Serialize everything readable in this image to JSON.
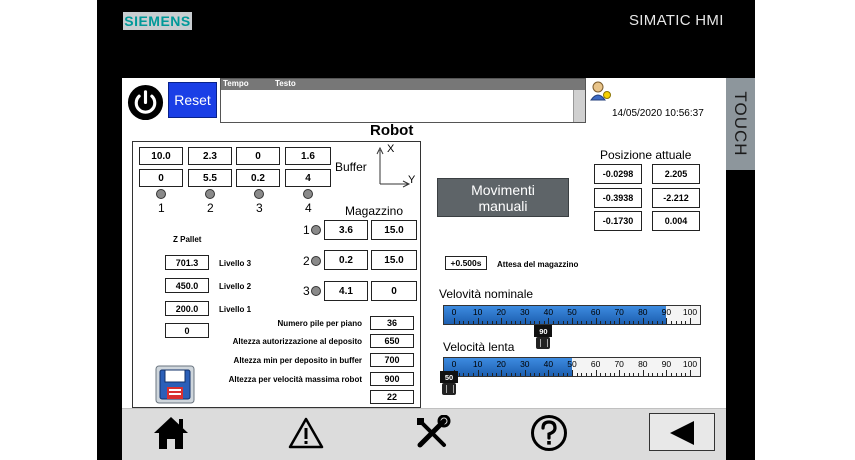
{
  "device": {
    "brand": "SIEMENS",
    "model": "SIMATIC HMI",
    "touch_label": "TOUCH"
  },
  "header": {
    "reset_label": "Reset",
    "alarm_cols": [
      "Tempo",
      "Testo"
    ],
    "datetime": "14/05/2020 10:56:37",
    "title": "Robot"
  },
  "buffer": {
    "label": "Buffer",
    "row1": [
      "10.0",
      "2.3",
      "0",
      "1.6"
    ],
    "row2": [
      "0",
      "5.5",
      "0.2",
      "4"
    ],
    "indices": [
      "1",
      "2",
      "3",
      "4"
    ],
    "axis_x": "X",
    "axis_y": "Y"
  },
  "magazzino": {
    "label": "Magazzino",
    "rows": [
      {
        "idx": "1",
        "a": "3.6",
        "b": "15.0"
      },
      {
        "idx": "2",
        "a": "0.2",
        "b": "15.0"
      },
      {
        "idx": "3",
        "a": "4.1",
        "b": "0"
      }
    ]
  },
  "pallet": {
    "title": "Z Pallet",
    "levels": [
      {
        "value": "701.3",
        "label": "Livello 3"
      },
      {
        "value": "450.0",
        "label": "Livello 2"
      },
      {
        "value": "200.0",
        "label": "Livello 1"
      }
    ],
    "zero_value": "0"
  },
  "params": [
    {
      "label": "Numero pile per piano",
      "value": "36"
    },
    {
      "label": "Altezza autorizzazione al deposito",
      "value": "650"
    },
    {
      "label": "Altezza min per deposito in buffer",
      "value": "700"
    },
    {
      "label": "Altezza per velocità massima robot",
      "value": "900"
    },
    {
      "label": "",
      "value": "22"
    }
  ],
  "manual": {
    "label": "Movimenti manuali"
  },
  "position": {
    "title": "Posizione attuale",
    "values": [
      "-0.0298",
      "2.205",
      "-0.3938",
      "-2.212",
      "-0.1730",
      "0.004"
    ]
  },
  "wait": {
    "value": "+0.500s",
    "label": "Attesa del magazzino"
  },
  "sliders": {
    "ticks": [
      "0",
      "10",
      "20",
      "30",
      "40",
      "50",
      "60",
      "70",
      "80",
      "90",
      "100"
    ],
    "nominal": {
      "label": "Velovità nominale",
      "value": 90,
      "value_text": "90"
    },
    "slow": {
      "label": "Velocità lenta",
      "value": 50,
      "value_text": "50"
    }
  },
  "colors": {
    "accent": "#1d5fb0",
    "reset_bg": "#1a3fe6",
    "nav_bg": "#dcdcdc",
    "brand_text": "#009999"
  },
  "nav": {
    "icons": [
      "home-icon",
      "warning-icon",
      "tools-icon",
      "help-icon",
      "back-arrow-icon"
    ]
  }
}
